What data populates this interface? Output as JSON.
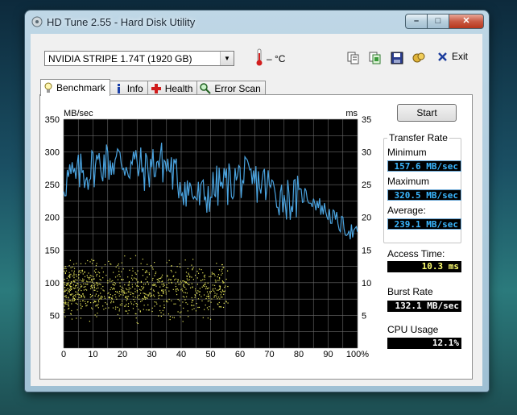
{
  "window": {
    "title": "HD Tune 2.55 - Hard Disk Utility"
  },
  "toolbar": {
    "drive": "NVIDIA  STRIPE     1.74T (1920 GB)",
    "temperature": "– °C",
    "exit_label": "Exit"
  },
  "tabs": [
    {
      "label": "Benchmark",
      "icon": "benchmark-icon",
      "active": true
    },
    {
      "label": "Info",
      "icon": "info-icon",
      "active": false
    },
    {
      "label": "Health",
      "icon": "health-icon",
      "active": false
    },
    {
      "label": "Error Scan",
      "icon": "error-scan-icon",
      "active": false
    }
  ],
  "controls": {
    "start_label": "Start"
  },
  "stats": {
    "transfer_rate_title": "Transfer Rate",
    "minimum_label": "Minimum",
    "minimum_value": "157.6 MB/sec",
    "maximum_label": "Maximum",
    "maximum_value": "320.5 MB/sec",
    "average_label": "Average:",
    "average_value": "239.1 MB/sec",
    "access_label": "Access Time:",
    "access_value": "10.3 ms",
    "burst_label": "Burst Rate",
    "burst_value": "132.1 MB/sec",
    "cpu_label": "CPU Usage",
    "cpu_value": "12.1%"
  },
  "colors": {
    "transfer_line": "#4aa3df",
    "access_dots": "#e6e65a",
    "plot_background": "#000000",
    "grid": "#6a6a6a"
  },
  "chart_data": {
    "type": "line",
    "left_unit": "MB/sec",
    "right_unit": "ms",
    "left_ticks": [
      "350",
      "300",
      "250",
      "200",
      "150",
      "100",
      "50"
    ],
    "right_ticks": [
      "35",
      "30",
      "25",
      "20",
      "15",
      "10",
      "5"
    ],
    "x_ticks": [
      "0",
      "10",
      "20",
      "30",
      "40",
      "50",
      "60",
      "70",
      "80",
      "90",
      "100%"
    ],
    "ylim_left": [
      0,
      350
    ],
    "ylim_right": [
      0,
      35
    ],
    "xlim": [
      0,
      100
    ],
    "grid": true,
    "series": [
      {
        "kind": "transfer_rate",
        "x": [
          0,
          2,
          4,
          6,
          8,
          10,
          12,
          14,
          16,
          18,
          20,
          22,
          24,
          26,
          28,
          30,
          32,
          34,
          36,
          38,
          40,
          42,
          44,
          46,
          48,
          50,
          52,
          54,
          56,
          58,
          60,
          62,
          64,
          66,
          68,
          70,
          72,
          74,
          76,
          78,
          80,
          82,
          84,
          86,
          88,
          90,
          92,
          94,
          96,
          98,
          100
        ],
        "values": [
          255,
          262,
          258,
          270,
          268,
          278,
          282,
          286,
          283,
          288,
          285,
          280,
          284,
          276,
          270,
          280,
          286,
          283,
          276,
          262,
          252,
          244,
          236,
          228,
          232,
          238,
          246,
          250,
          252,
          256,
          262,
          258,
          252,
          254,
          252,
          246,
          238,
          234,
          230,
          228,
          232,
          235,
          228,
          222,
          214,
          206,
          198,
          190,
          184,
          178,
          172
        ]
      },
      {
        "kind": "access_time",
        "x_range": [
          0,
          56
        ],
        "values_range_ms": [
          3,
          15
        ],
        "density_center_ms": 9.5
      }
    ]
  }
}
